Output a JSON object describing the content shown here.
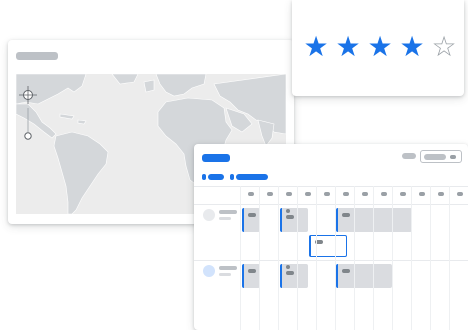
{
  "rating": {
    "value": 4,
    "max": 5,
    "filled_star_glyph": "★",
    "empty_star_glyph": "☆",
    "filled_color": "#1a73e8",
    "empty_color": "#9aa0a6"
  },
  "map": {
    "pin_icon": "map-pin-icon"
  },
  "schedule": {
    "accent_color": "#1a73e8",
    "rows": 2,
    "columns": 12
  },
  "colors": {
    "accent": "#1a73e8",
    "placeholder": "#bdc1c6",
    "map_land": "#d4d7da",
    "map_water": "#ececec"
  }
}
